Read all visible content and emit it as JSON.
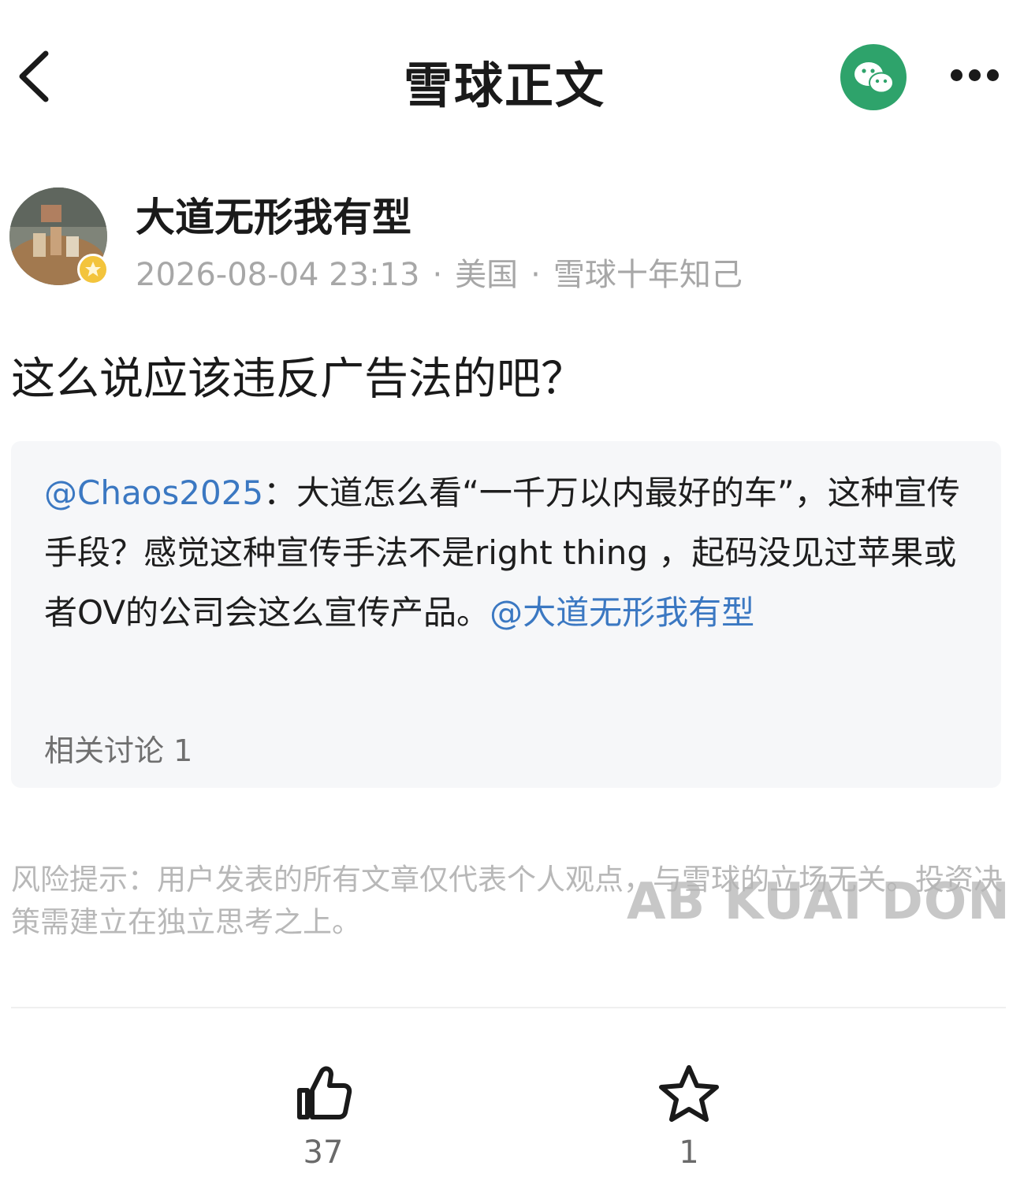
{
  "header": {
    "title": "雪球正文",
    "back_icon": "chevron-left-icon",
    "share_icon": "wechat-icon",
    "more_icon": "more-dots-icon",
    "accent_color": "#2ea36b"
  },
  "author": {
    "name": "大道无形我有型",
    "datetime": "2026-08-04 23:13",
    "location": "美国",
    "tag": "雪球十年知己",
    "separator": "·"
  },
  "post": {
    "text": "这么说应该违反广告法的吧？"
  },
  "quote": {
    "user": "@Chaos2025",
    "colon": "：",
    "text": "大道怎么看“一千万以内最好的车”，这种宣传手段？感觉这种宣传手法不是right thing ，起码没见过苹果或者OV的公司会这么宣传产品。",
    "mention": "@大道无形我有型",
    "related": "相关讨论 1",
    "link_color": "#3b78c2"
  },
  "risk_notice": "风险提示：用户发表的所有文章仅代表个人观点，与雪球的立场无关。投资决策需建立在独立思考之上。",
  "watermark": "AB KUAI DONG",
  "actions": {
    "like": {
      "icon": "thumbs-up-icon",
      "count": "37"
    },
    "favorite": {
      "icon": "star-icon",
      "count": "1"
    }
  }
}
